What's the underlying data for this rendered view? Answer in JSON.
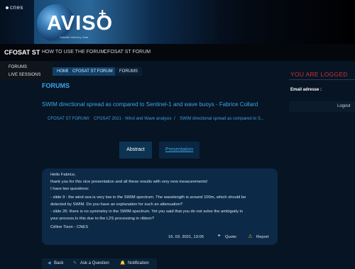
{
  "brand": {
    "org": "cnes",
    "title": "AVISO",
    "plus": "+",
    "subtitle": "Satellite Altimetry Data"
  },
  "nav": {
    "brand": "CFOSAT ST",
    "links": [
      "HOW TO USE THE FORUM",
      "CFOSAT ST FORUM"
    ],
    "dropdown": [
      "FORUMS",
      "LIVE SESSIONS"
    ]
  },
  "breadcrumb": [
    "HOME",
    "CFOSAT ST FORUM",
    "FORUMS"
  ],
  "main": {
    "section_title": "FORUMS",
    "topic_title": "SWIM directional spread as compared to Sentinel-1 and wave buoys - Fabrice Collard",
    "crumbs": [
      "CFOSAT ST FORUM",
      "CFOSAT 2021 - Wind and Wave analysis",
      "SWIM directional spread as compared to S..."
    ],
    "tabs": [
      "Abstract",
      "Presentation"
    ]
  },
  "post": {
    "lines": [
      "Hello Fabrice,",
      "thank you for this nice presentation and all these results with very new measurements!",
      "I have two questions:",
      "- slide 9 : the wind sea is very low in the SWIM spectrum. The wavelength is around 100m, which should be",
      "detected by SWIM. Do you have an explanation for such an attenuation?",
      "- slide 26: there is no symmetry in the SWIM spectrum. Yet you said that you do not solve the ambiguity in",
      "your process.Is this due to the L2S processing in ribbon?",
      "",
      "Céline Tison - CNES"
    ],
    "date": "16. 03. 2021, 13:05",
    "quote_label": "Quote",
    "report_label": "Report"
  },
  "actions": {
    "back": "Back",
    "ask": "Ask a Question",
    "notification": "Notification"
  },
  "sidebar": {
    "title": "YOU ARE LOGGED",
    "email_label": "Email adresse :",
    "logout": "Logout"
  },
  "colors": {
    "accent": "#3fa7e6",
    "alert": "#d2322f",
    "background": "#061424"
  }
}
